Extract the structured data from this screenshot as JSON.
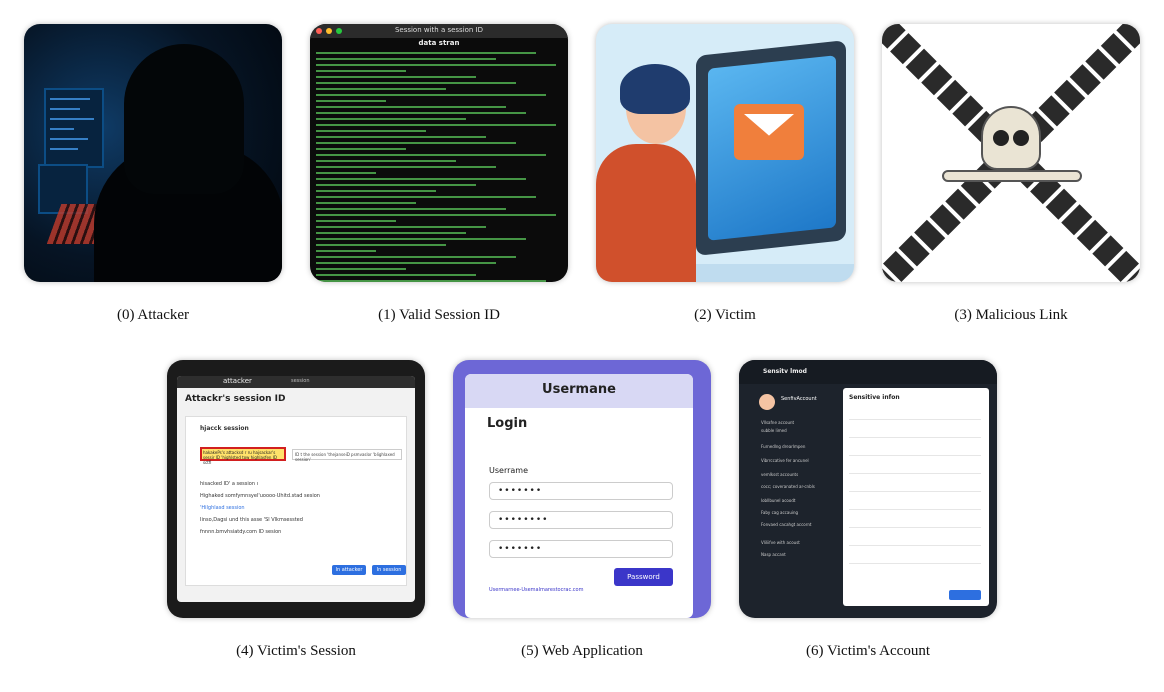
{
  "captions": [
    "(0) Attacker",
    "(1) Valid Session ID",
    "(2) Victim",
    "(3) Malicious Link",
    "(4) Victim's Session",
    "(5) Web Application",
    "(6) Victim's Account"
  ],
  "terminal": {
    "title": "Session with a session ID",
    "subtitle": "data stran"
  },
  "session_window": {
    "tab": "attacker",
    "tab2": "session",
    "title": "Attackr's session ID",
    "section": "hjacck session",
    "highlight": "hakakePs's attacksd r ru hajsackar's sessir ID 'highlsted tow highlasfen ID sctfi",
    "field": "ID t the session 'thejanseiD psmvaslor 'blighlaxed session'",
    "lines": [
      "hisacked ID' a session ı",
      "Highaked somfymnsyel'uoooo·Uhitd.stad sesion",
      "'Hilghlasd session",
      "Iinso,Dagsi und this asse 'Sl Vlkmsessted",
      "fnnnn.bmvhsiatdy.com ID sesion"
    ],
    "btn_attacker": "In attacker",
    "btn_session": "In session"
  },
  "login": {
    "brand": "Usermane",
    "title": "Login",
    "label": "Userrame",
    "field1": "•••••••",
    "field2": "••••••••",
    "field3": "•••••••",
    "button": "Password",
    "link": "Usermarnee-Usemalmarestocrac.com"
  },
  "account": {
    "brand": "Sensitv lmod",
    "user": "SenfivAccount",
    "heading": "Sensitive infon",
    "menu": [
      "Vllsafne account",
      "subble limed",
      "Furnedlng drearlmpen",
      "Vibrrccative fer ancunel",
      "vemlksst accounts",
      "cocc; coveranated ar-cnbls",
      "lobllbunel acoodt",
      "Faby cag accauing",
      "Fonvaed cacahgt accornt",
      "Vliliifve with acoust",
      "Nasp accant"
    ]
  }
}
